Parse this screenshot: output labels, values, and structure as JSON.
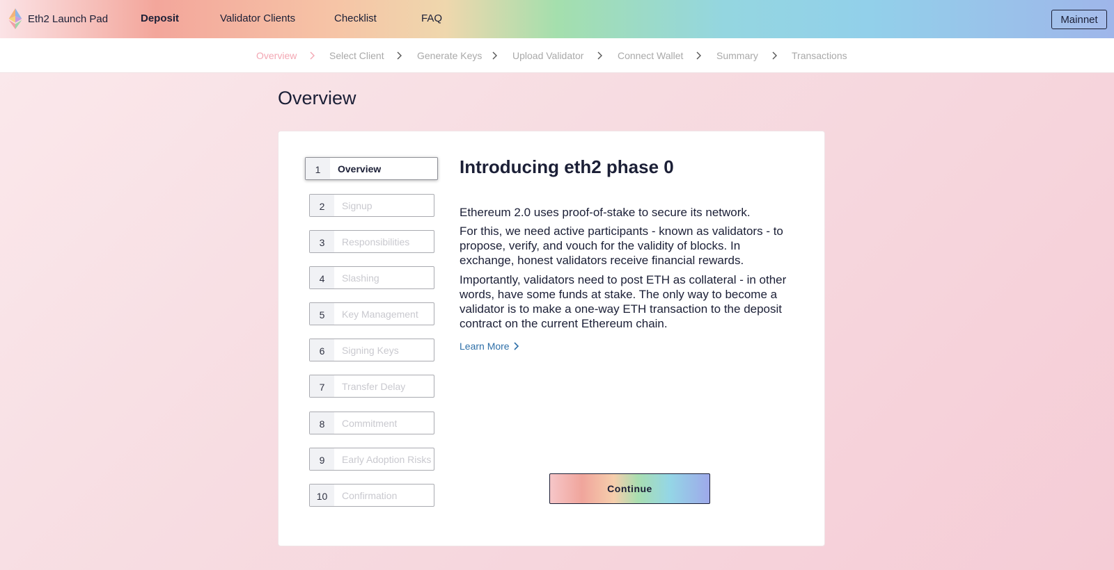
{
  "brand": {
    "name": "Eth2 Launch Pad",
    "logo_icon": "ethereum-logo-icon"
  },
  "nav": {
    "items": [
      {
        "label": "Deposit",
        "active": true
      },
      {
        "label": "Validator Clients",
        "active": false
      },
      {
        "label": "Checklist",
        "active": false
      },
      {
        "label": "FAQ",
        "active": false
      }
    ],
    "network_label": "Mainnet"
  },
  "progress": {
    "steps": [
      "Overview",
      "Select Client",
      "Generate Keys",
      "Upload Validator",
      "Connect Wallet",
      "Summary",
      "Transactions"
    ],
    "current": "Overview",
    "separator_icon": "chevron-right-icon"
  },
  "page": {
    "title": "Overview"
  },
  "sidebar": {
    "steps": [
      {
        "num": "1",
        "label": "Overview",
        "active": true
      },
      {
        "num": "2",
        "label": "Signup",
        "active": false
      },
      {
        "num": "3",
        "label": "Responsibilities",
        "active": false
      },
      {
        "num": "4",
        "label": "Slashing",
        "active": false
      },
      {
        "num": "5",
        "label": "Key Management",
        "active": false
      },
      {
        "num": "6",
        "label": "Signing Keys",
        "active": false
      },
      {
        "num": "7",
        "label": "Transfer Delay",
        "active": false
      },
      {
        "num": "8",
        "label": "Commitment",
        "active": false
      },
      {
        "num": "9",
        "label": "Early Adoption Risks",
        "active": false
      },
      {
        "num": "10",
        "label": "Confirmation",
        "active": false
      }
    ]
  },
  "content": {
    "title": "Introducing eth2 phase 0",
    "paragraphs": [
      "Ethereum 2.0 uses proof-of-stake to secure its network.",
      "For this, we need active participants - known as validators - to propose, verify, and vouch for the validity of blocks. In exchange, honest validators receive financial rewards.",
      "Importantly, validators need to post ETH as collateral - in other words, have some funds at stake. The only way to become a validator is to make a one-way ETH transaction to the deposit contract on the current Ethereum chain."
    ],
    "learn_more": "Learn More",
    "continue_label": "Continue"
  },
  "colors": {
    "text_dark": "#1b1f36",
    "step_current": "#f3a7b3",
    "step_inactive": "#a9a9a9",
    "link": "#2e6fa8"
  }
}
